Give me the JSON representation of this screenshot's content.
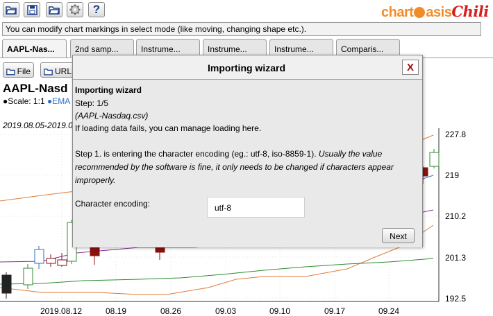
{
  "toolbar": {
    "icons": [
      "open-folder-icon",
      "save-disk-icon",
      "open-folder-icon",
      "gear-icon",
      "help-icon"
    ],
    "help_label": "?"
  },
  "logo": {
    "part1": "chart",
    "part2": "asis",
    "part3": "Chili",
    "accent": "#f28c28",
    "brand_red": "#d81e1e"
  },
  "infobar": {
    "text": "You can modify chart markings in select mode (like moving, changing shape etc.)."
  },
  "tabs": [
    {
      "label": "AAPL-Nas..."
    },
    {
      "label": "2nd samp..."
    },
    {
      "label": "Instrume..."
    },
    {
      "label": "Instrume..."
    },
    {
      "label": "Instrume..."
    },
    {
      "label": "Comparis..."
    }
  ],
  "subtoolbar": {
    "file_label": "File",
    "url_label": "URL"
  },
  "chart": {
    "title": "AAPL-Nasd",
    "scale_prefix": "●Scale: 1:1 ",
    "ema_label": "●EMA",
    "range": "2019.08.05-2019.0",
    "ylabels": [
      "227.8",
      "219",
      "210.2",
      "201.3",
      "192.5"
    ],
    "xlabels": [
      "2019.08.12",
      "08.19",
      "08.26",
      "09.03",
      "09.10",
      "09.17",
      "09.24"
    ]
  },
  "chart_data": {
    "type": "line",
    "x": [
      "2019.08.12",
      "08.19",
      "08.26",
      "09.03",
      "09.10",
      "09.17",
      "09.24"
    ],
    "y_ticks": [
      227.8,
      219,
      210.2,
      201.3,
      192.5
    ],
    "ylim": [
      192.5,
      227.8
    ],
    "candles": [
      {
        "o": 195.5,
        "c": 191.8,
        "h": 196.5,
        "l": 191.5,
        "up": false
      },
      {
        "o": 194.0,
        "c": 197.5,
        "h": 198.0,
        "l": 193.5,
        "up": true
      },
      {
        "o": 197.0,
        "c": 200.5,
        "h": 201.5,
        "l": 196.5,
        "up": true
      }
    ],
    "ema_color": "#2b6fc6"
  },
  "modal": {
    "title": "Importing wizard",
    "close_label": "X",
    "heading": "Importing wizard",
    "step": "Step: 1/5",
    "file": "(AAPL-Nasdaq.csv)",
    "hint": "If loading data fails, you can manage loading here.",
    "para_normal": "Step 1. is entering the character encoding (eg.: utf-8, iso-8859-1). ",
    "para_italic": "Usually the value recommended by the software is fine, it only needs to be changed if characters appear improperly.",
    "encoding_label": "Character encoding:",
    "encoding_value": "utf-8",
    "next_label": "Next"
  }
}
